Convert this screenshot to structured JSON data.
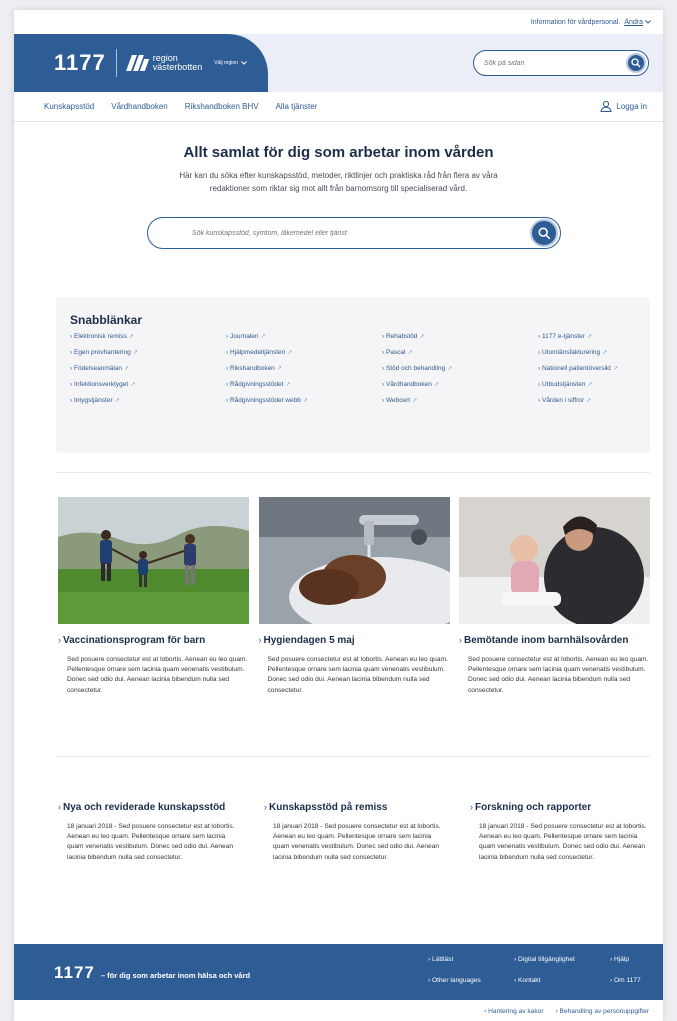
{
  "utility": {
    "text": "Information för vårdpersonal.",
    "change": "Ändra"
  },
  "header": {
    "logo": "1177",
    "region_line1": "region",
    "region_line2": "västerbotten",
    "region_picker": "Välj region",
    "search_placeholder": "Sök på sidan"
  },
  "nav": {
    "items": [
      "Kunskapsstöd",
      "Vårdhandboken",
      "Rikshandboken BHV",
      "Alla tjänster"
    ],
    "login": "Logga in"
  },
  "hero": {
    "title": "Allt samlat för dig som arbetar inom vården",
    "intro": "Här kan du söka efter kunskapsstöd, metoder, riktlinjer och praktiska råd från flera av våra redaktioner som riktar sig mot allt från barnomsorg till specialiserad vård.",
    "search_placeholder": "Sök kunskapsstöd, symtom, läkemedel eller tjänst"
  },
  "quick": {
    "title": "Snabblänkar",
    "links": [
      "Elektronisk remiss",
      "Journalen",
      "Rehabstöd",
      "1177 e-tjänster",
      "Egen provhantering",
      "Hjälpmedeltjänsten",
      "Pascal",
      "Utomlänsfakturering",
      "Födelseanmälan",
      "Rikshandboken",
      "Stöd och behandling",
      "Nationell patientöversikt",
      "Infektionsverktyget",
      "Rådgivningsstödet",
      "Vårdhandboken",
      "Utbudstjänsten",
      "Intygstjänster",
      "Rådgivningsstödet webb",
      "Webcert",
      "Vården i siffror"
    ]
  },
  "cards": [
    {
      "title": "Vaccinationsprogram för barn",
      "text": "Sed posuere consectetur est at lobortis. Aenean eu leo quam. Pellentesque ornare sem lacinia quam venenatis vestibulum. Donec sed odio dui. Aenean lacinia bibendum nulla sed consectetur."
    },
    {
      "title": "Hygiendagen 5 maj",
      "text": "Sed posuere consectetur est at lobortis. Aenean eu leo quam. Pellentesque ornare sem lacinia quam venenatis vestibulum. Donec sed odio dui. Aenean lacinia bibendum nulla sed consectetur."
    },
    {
      "title": "Bemötande inom barnhälsovården",
      "text": "Sed posuere consectetur est at lobortis. Aenean eu leo quam. Pellentesque ornare sem lacinia quam venenatis vestibulum. Donec sed odio dui. Aenean lacinia bibendum nulla sed consectetur."
    }
  ],
  "news": [
    {
      "title": "Nya och reviderade kunskapsstöd",
      "text": "18 januari 2018 - Sed posuere consectetur est at lobortis. Aenean eu leo quam. Pellentesque ornare sem lacinia quam venenatis vestibulum. Donec sed odio dui. Aenean lacinia bibendum nulla sed consectetur."
    },
    {
      "title": "Kunskapsstöd på remiss",
      "text": "18 januari 2018 - Sed posuere consectetur est at lobortis. Aenean eu leo quam. Pellentesque ornare sem lacinia quam venenatis vestibulum. Donec sed odio dui. Aenean lacinia bibendum nulla sed consectetur."
    },
    {
      "title": "Forskning och rapporter",
      "text": "18 januari 2018 - Sed posuere consectetur est at lobortis. Aenean eu leo quam. Pellentesque ornare sem lacinia quam venenatis vestibulum. Donec sed odio dui. Aenean lacinia bibendum nulla sed consectetur."
    }
  ],
  "footer": {
    "logo": "1177",
    "tagline": "– för dig som arbetar inom hälsa och vård",
    "links": [
      "Lättläst",
      "Digital tillgänglighet",
      "Hjälp",
      "Other languages",
      "Kontakt",
      "Om 1177"
    ],
    "sub_links": [
      "Hantering av kakor",
      "Behandling av personuppgifter"
    ]
  },
  "colors": {
    "brand": "#2e5c94",
    "header_bg": "#ebeef6",
    "heading": "#1e2c4b"
  }
}
